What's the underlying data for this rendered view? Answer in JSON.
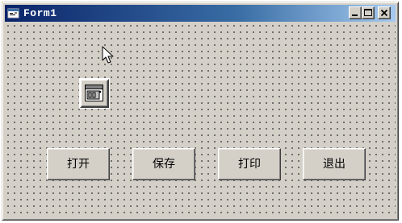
{
  "window": {
    "title": "Form1",
    "title_bar_color": "#0a246a",
    "background_color": "#d4d0c8",
    "icon": "form-icon",
    "caption_buttons": {
      "minimize_icon": "minimize-icon",
      "maximize_icon": "maximize-icon",
      "close_icon": "close-icon"
    }
  },
  "designer": {
    "grid": true,
    "cursor_icon": "arrow-cursor-icon",
    "timer_icon": "timer-icon"
  },
  "buttons": [
    {
      "label": "打开"
    },
    {
      "label": "保存"
    },
    {
      "label": "打印"
    },
    {
      "label": "退出"
    }
  ]
}
